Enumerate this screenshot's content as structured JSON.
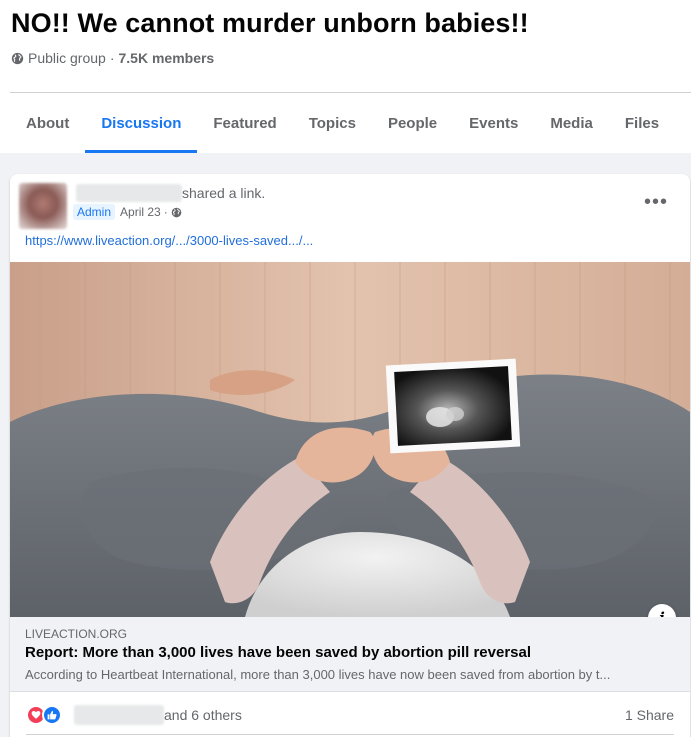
{
  "group": {
    "title": "NO!! We cannot murder unborn babies!!",
    "privacy": "Public group",
    "separator": "·",
    "members": "7.5K members"
  },
  "tabs": [
    {
      "label": "About",
      "active": false
    },
    {
      "label": "Discussion",
      "active": true
    },
    {
      "label": "Featured",
      "active": false
    },
    {
      "label": "Topics",
      "active": false
    },
    {
      "label": "People",
      "active": false
    },
    {
      "label": "Events",
      "active": false
    },
    {
      "label": "Media",
      "active": false
    },
    {
      "label": "Files",
      "active": false
    }
  ],
  "post": {
    "action": "shared a link.",
    "badge": "Admin",
    "date": "April 23",
    "dot": "·",
    "more": "•••",
    "link_url": "https://www.liveaction.org/.../3000-lives-saved.../...",
    "preview": {
      "domain": "LIVEACTION.ORG",
      "title": "Report: More than 3,000 lives have been saved by abortion pill reversal",
      "description": "According to Heartbeat International, more than 3,000 lives have now been saved from abortion by t...",
      "info_glyph": "i"
    },
    "reactions": {
      "types": [
        "love",
        "like"
      ],
      "others_text": "and 6 others",
      "share_text": "1 Share"
    }
  },
  "colors": {
    "accent": "#1877f2",
    "secondary_text": "#65676b",
    "feed_background": "#f0f2f5",
    "love": "#f33e58"
  },
  "icons": {
    "privacy": "globe-icon",
    "post_audience": "globe-icon",
    "menu": "more-options-icon",
    "preview_info": "info-icon"
  }
}
